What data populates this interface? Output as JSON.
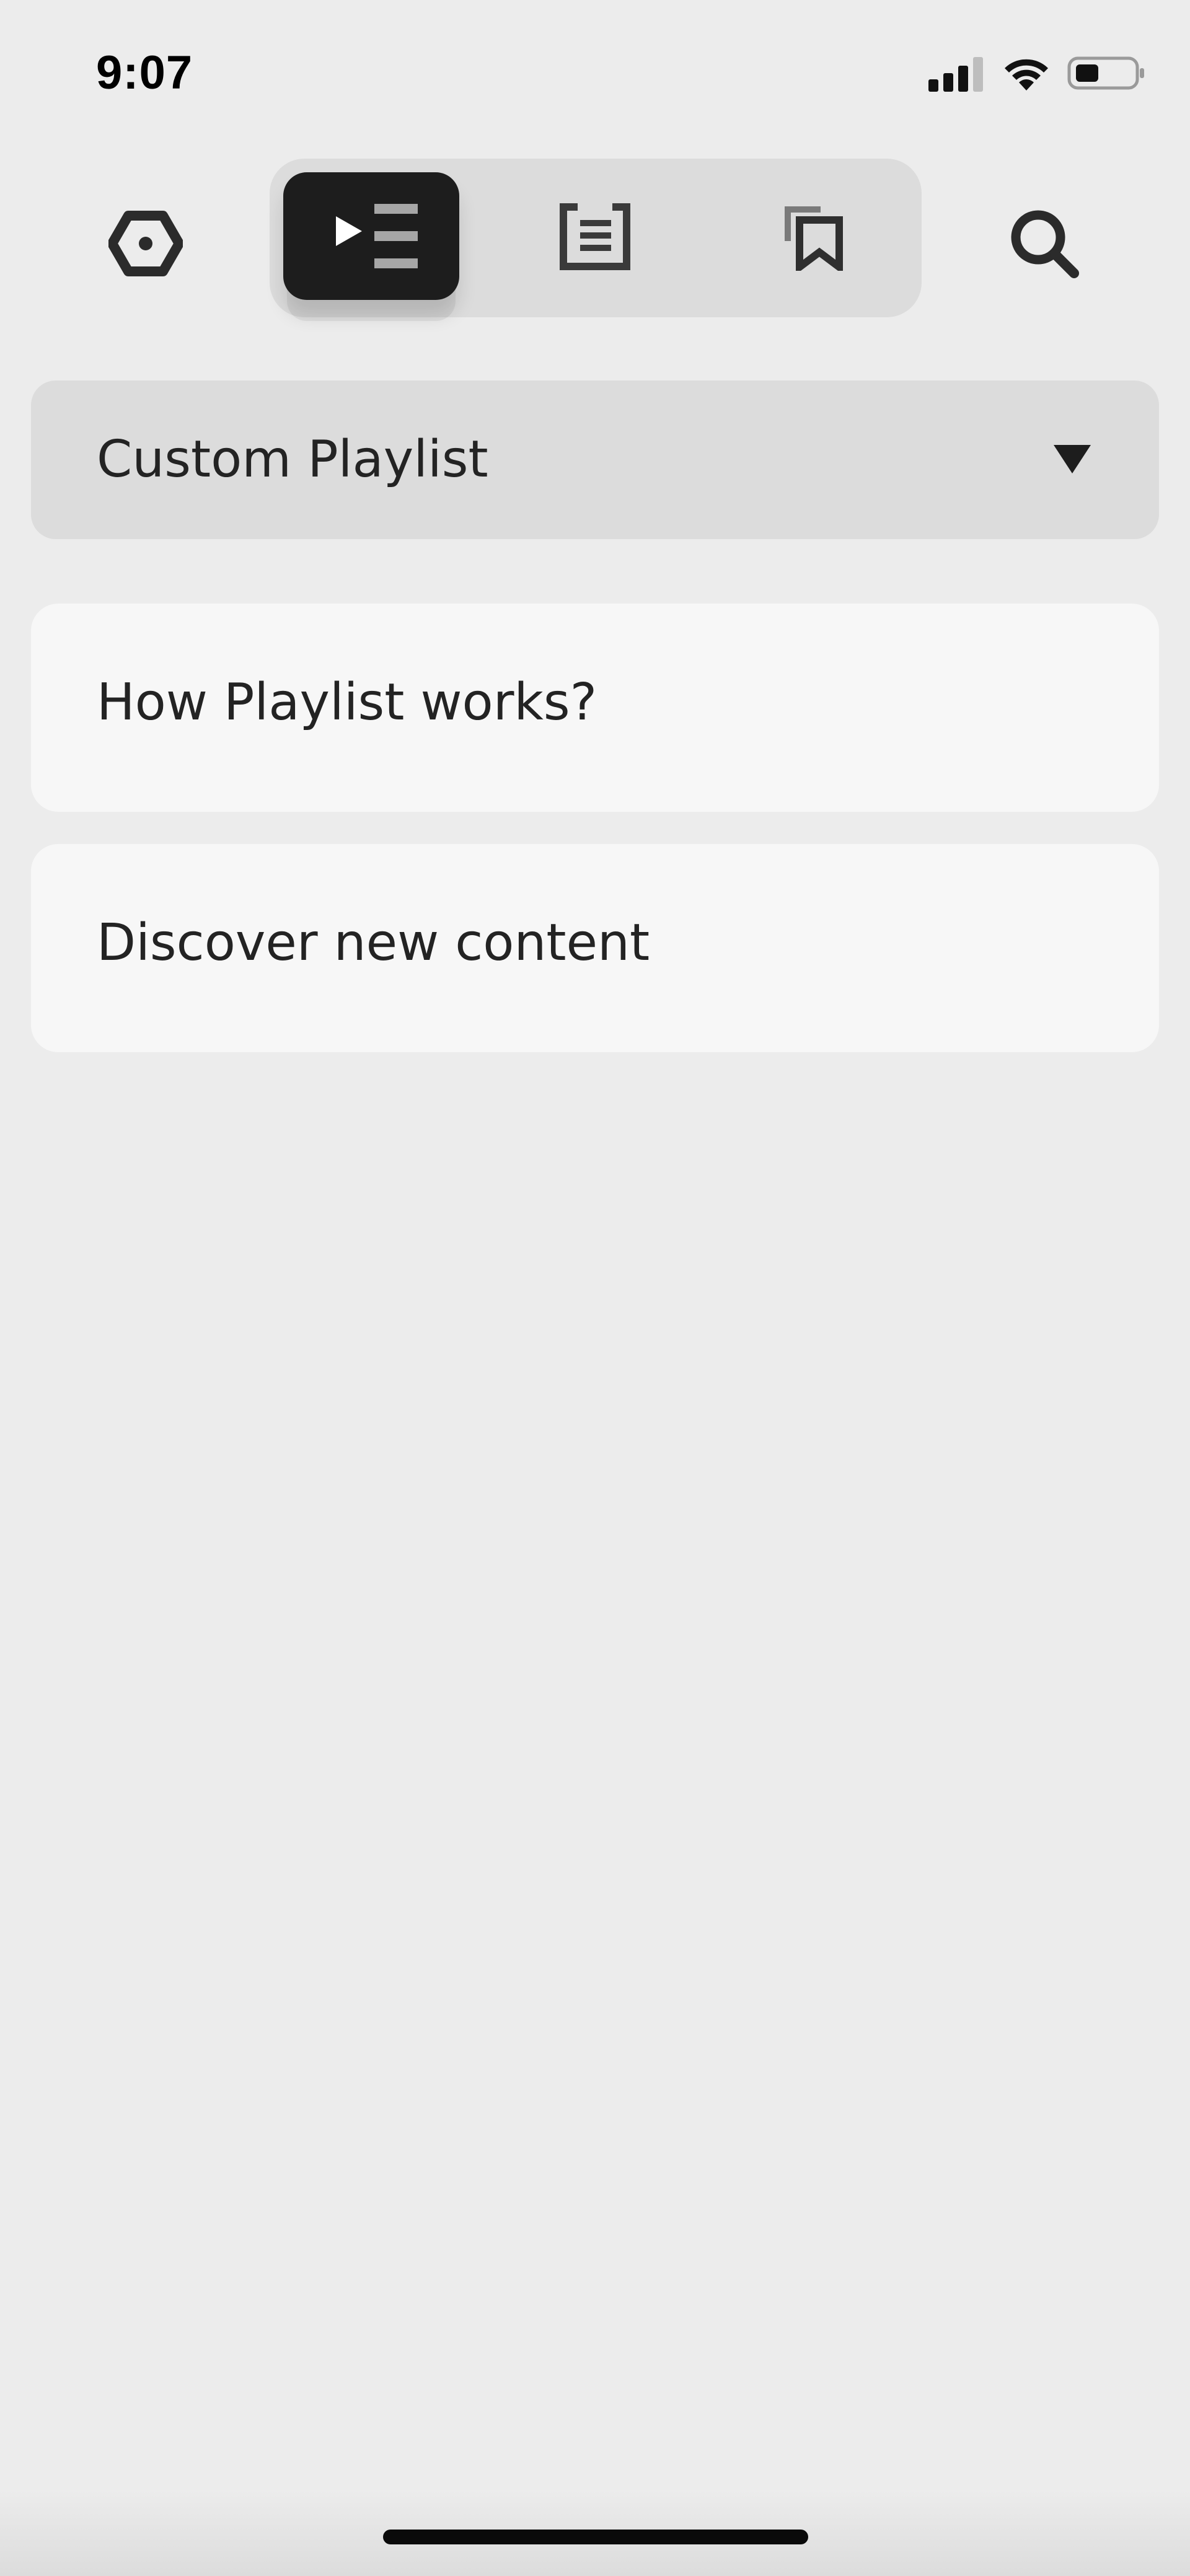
{
  "status_bar": {
    "time": "9:07"
  },
  "toolbar": {
    "settings_icon": "hexagon-settings-icon",
    "search_icon": "search-icon",
    "segments": [
      {
        "icon": "playlist-icon",
        "active": true
      },
      {
        "icon": "article-list-icon",
        "active": false
      },
      {
        "icon": "bookmarks-icon",
        "active": false
      }
    ]
  },
  "dropdown": {
    "selected": "Custom Playlist"
  },
  "cards": [
    {
      "label": "How Playlist works?"
    },
    {
      "label": "Discover new content"
    }
  ],
  "colors": {
    "background": "#ececec",
    "surface": "#dcdcdc",
    "card": "#f7f7f7",
    "active": "#1d1d1d",
    "text": "#232323"
  }
}
